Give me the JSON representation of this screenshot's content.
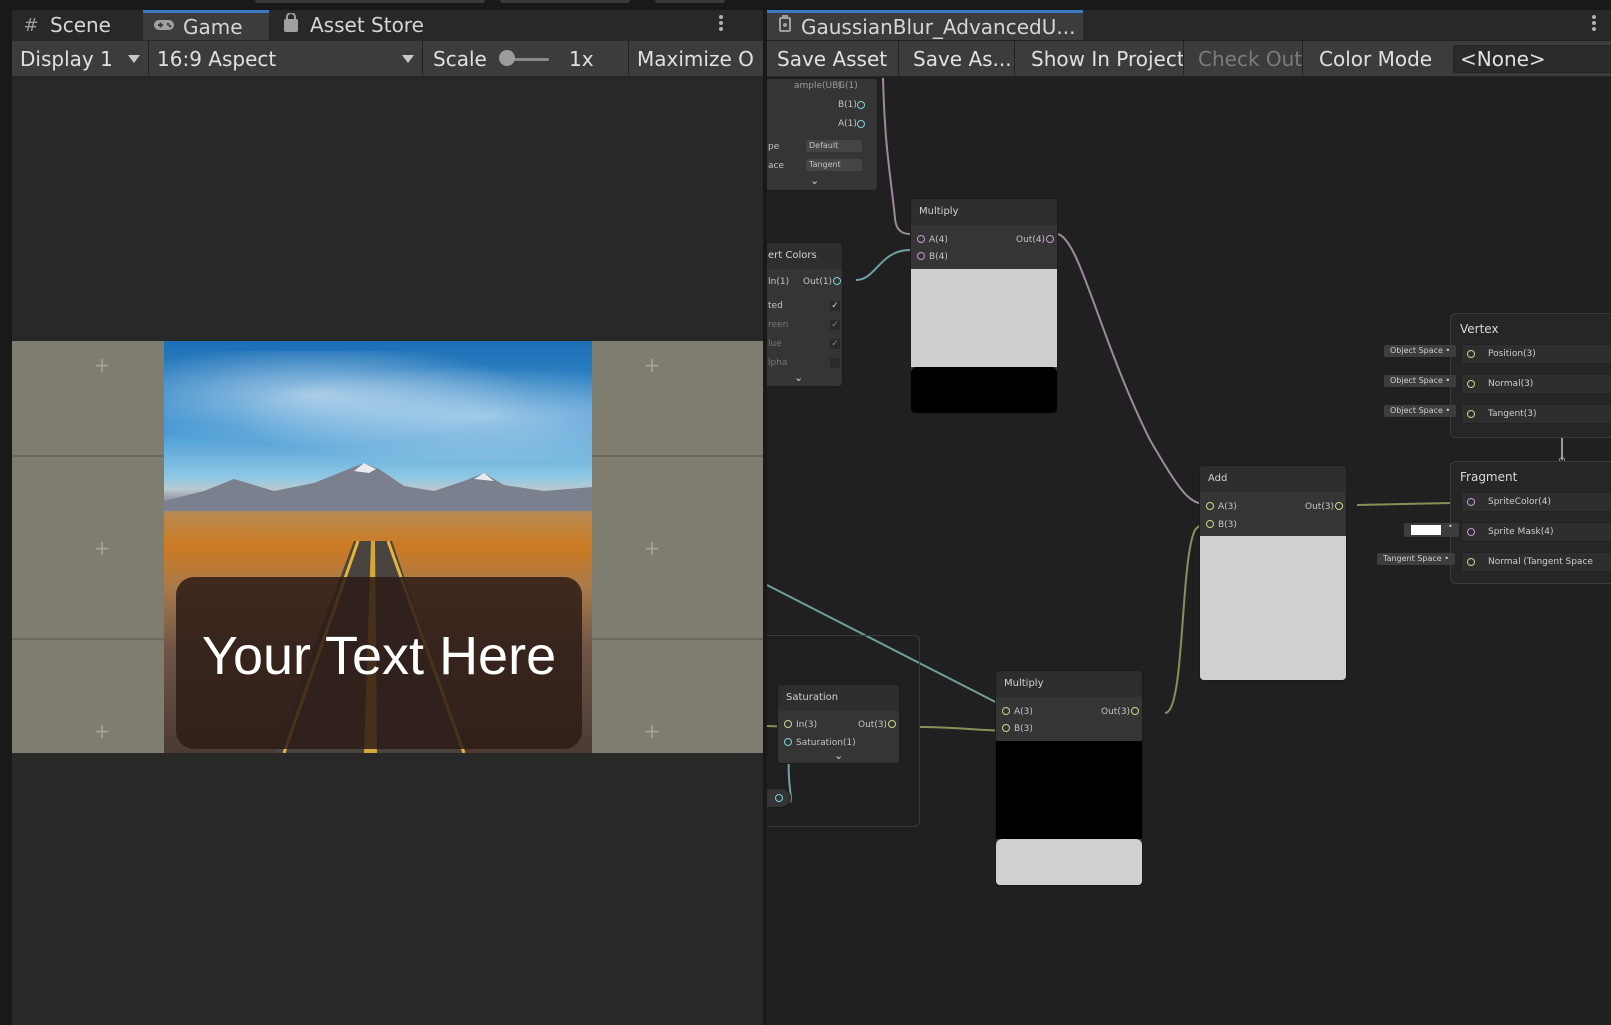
{
  "left_panel": {
    "tabs": [
      {
        "label": "Scene",
        "icon": "hash-icon"
      },
      {
        "label": "Game",
        "icon": "gamepad-icon"
      },
      {
        "label": "Asset Store",
        "icon": "shopping-bag-icon"
      }
    ],
    "toolbar": {
      "display": "Display 1",
      "aspect": "16:9 Aspect",
      "scale_label": "Scale",
      "scale_value": "1x",
      "maximize": "Maximize O"
    },
    "game_view": {
      "card_text": "Your Text Here"
    }
  },
  "right_panel": {
    "tab_title": "GaussianBlur_AdvancedU...",
    "toolbar": {
      "save_asset": "Save Asset",
      "save_as": "Save As...",
      "show_in_project": "Show In Project",
      "check_out": "Check Out",
      "color_mode_label": "Color Mode",
      "color_mode_value": "<None>"
    },
    "graph": {
      "sample_node": {
        "title_fragment": "ample(UB)",
        "ports": [
          "G(1)",
          "B(1)",
          "A(1)"
        ],
        "type_label": "pe",
        "type_value": "Default",
        "space_label": "ace",
        "space_value": "Tangent"
      },
      "invert_node": {
        "title": "ert Colors",
        "input": "In(1)",
        "output": "Out(1)",
        "toggles": [
          {
            "label": "ted",
            "checked": true
          },
          {
            "label": "reen",
            "checked": true
          },
          {
            "label": "lue",
            "checked": true
          },
          {
            "label": "lpha",
            "checked": false
          }
        ]
      },
      "multiply_top": {
        "title": "Multiply",
        "inputs": [
          "A(4)",
          "B(4)"
        ],
        "output": "Out(4)"
      },
      "add_node": {
        "title": "Add",
        "inputs": [
          "A(3)",
          "B(3)"
        ],
        "output": "Out(3)"
      },
      "saturation_node": {
        "title": "Saturation",
        "inputs": [
          "In(3)",
          "Saturation(1)"
        ],
        "output": "Out(3)"
      },
      "multiply_bottom": {
        "title": "Multiply",
        "inputs": [
          "A(3)",
          "B(3)"
        ],
        "output": "Out(3)"
      },
      "vertex_stack": {
        "title": "Vertex",
        "rows": [
          {
            "label": "Position(3)",
            "space": "Object Space"
          },
          {
            "label": "Normal(3)",
            "space": "Object Space"
          },
          {
            "label": "Tangent(3)",
            "space": "Object Space"
          }
        ]
      },
      "fragment_stack": {
        "title": "Fragment",
        "rows": [
          {
            "label": "SpriteColor(4)",
            "space": ""
          },
          {
            "label": "Sprite Mask(4)",
            "space": ""
          },
          {
            "label": "Normal (Tangent Space",
            "space": "Tangent Space"
          }
        ]
      }
    }
  },
  "colors": {
    "accent_tab": "#3a78c2",
    "wire_vec4": "#9c8a9e",
    "wire_vec3": "#8a8f5a",
    "wire_vec1": "#6fa3a6",
    "port_vec4": "#c995d7",
    "port_vec3": "#cfd48a",
    "port_vec1": "#7bd0d8"
  }
}
